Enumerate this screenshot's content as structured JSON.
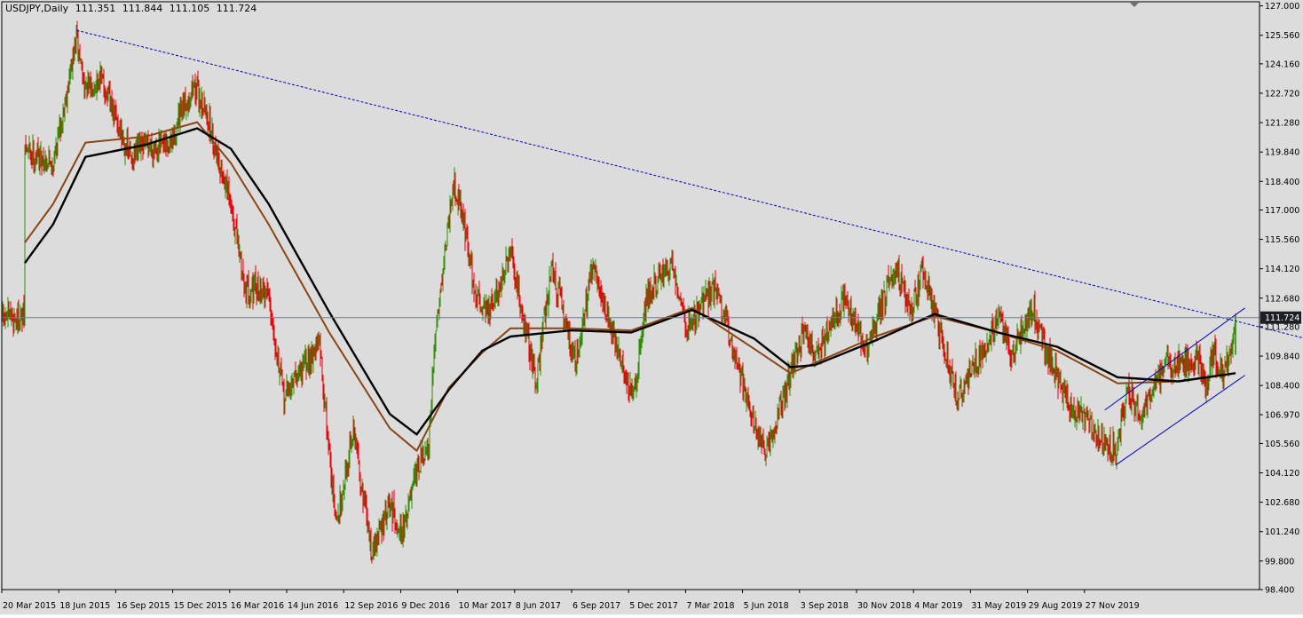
{
  "header": {
    "symbol": "USDJPY,Daily",
    "open": "111.351",
    "high": "111.844",
    "low": "111.105",
    "close": "111.724"
  },
  "colors": {
    "background": "#dcdcdc",
    "frame": "#000000",
    "bull_candle": "#2f8f00",
    "bear_candle": "#e8000b",
    "ma_fast": "#8b4513",
    "ma_slow": "#000000",
    "trendlines": "#0000cc",
    "price_line": "#6e7f8f",
    "current_price_bg": "#1c2026",
    "current_price_fg": "#ffffff"
  },
  "chart_data": {
    "type": "candlestick",
    "symbol": "USDJPY",
    "timeframe": "Daily",
    "current_price": 111.724,
    "y_range": [
      98.4,
      127.2
    ],
    "y_ticks": [
      "127.000",
      "125.560",
      "124.160",
      "122.720",
      "121.280",
      "119.840",
      "118.400",
      "117.000",
      "115.560",
      "114.120",
      "112.680",
      "111.280",
      "109.840",
      "108.400",
      "106.970",
      "105.560",
      "104.120",
      "102.680",
      "101.240",
      "99.800",
      "98.400"
    ],
    "x_ticks": [
      "20 Mar 2015",
      "18 Jun 2015",
      "16 Sep 2015",
      "15 Dec 2015",
      "16 Mar 2016",
      "14 Jun 2016",
      "12 Sep 2016",
      "9 Dec 2016",
      "10 Mar 2017",
      "8 Jun 2017",
      "6 Sep 2017",
      "5 Dec 2017",
      "7 Mar 2018",
      "5 Jun 2018",
      "3 Sep 2018",
      "30 Nov 2018",
      "4 Mar 2019",
      "31 May 2019",
      "29 Aug 2019",
      "27 Nov 2019"
    ],
    "price_path": [
      {
        "date": "2015-03-20",
        "close": 120.0
      },
      {
        "date": "2015-05-01",
        "close": 119.3
      },
      {
        "date": "2015-06-05",
        "close": 125.4
      },
      {
        "date": "2015-06-18",
        "close": 122.8
      },
      {
        "date": "2015-07-10",
        "close": 123.5
      },
      {
        "date": "2015-08-24",
        "close": 119.5
      },
      {
        "date": "2015-09-16",
        "close": 120.2
      },
      {
        "date": "2015-10-20",
        "close": 120.0
      },
      {
        "date": "2015-11-25",
        "close": 123.2
      },
      {
        "date": "2015-12-15",
        "close": 121.7
      },
      {
        "date": "2016-01-20",
        "close": 117.2
      },
      {
        "date": "2016-02-10",
        "close": 113.2
      },
      {
        "date": "2016-03-16",
        "close": 113.0
      },
      {
        "date": "2016-04-07",
        "close": 107.8
      },
      {
        "date": "2016-05-10",
        "close": 109.5
      },
      {
        "date": "2016-05-30",
        "close": 110.5
      },
      {
        "date": "2016-06-14",
        "close": 105.2
      },
      {
        "date": "2016-06-24",
        "close": 101.5
      },
      {
        "date": "2016-07-20",
        "close": 106.3
      },
      {
        "date": "2016-08-16",
        "close": 100.2
      },
      {
        "date": "2016-09-12",
        "close": 102.5
      },
      {
        "date": "2016-09-30",
        "close": 101.2
      },
      {
        "date": "2016-10-28",
        "close": 104.8
      },
      {
        "date": "2016-11-09",
        "close": 105.2
      },
      {
        "date": "2016-11-18",
        "close": 110.9
      },
      {
        "date": "2016-12-15",
        "close": 118.4
      },
      {
        "date": "2016-12-27",
        "close": 117.2
      },
      {
        "date": "2017-01-17",
        "close": 112.8
      },
      {
        "date": "2017-02-08",
        "close": 112.0
      },
      {
        "date": "2017-03-10",
        "close": 114.8
      },
      {
        "date": "2017-04-17",
        "close": 108.6
      },
      {
        "date": "2017-05-10",
        "close": 114.3
      },
      {
        "date": "2017-06-14",
        "close": 109.6
      },
      {
        "date": "2017-07-11",
        "close": 114.2
      },
      {
        "date": "2017-09-08",
        "close": 107.6
      },
      {
        "date": "2017-09-28",
        "close": 112.8
      },
      {
        "date": "2017-11-06",
        "close": 114.4
      },
      {
        "date": "2017-11-27",
        "close": 111.2
      },
      {
        "date": "2018-01-08",
        "close": 113.3
      },
      {
        "date": "2018-03-23",
        "close": 104.8
      },
      {
        "date": "2018-05-21",
        "close": 111.2
      },
      {
        "date": "2018-06-05",
        "close": 109.8
      },
      {
        "date": "2018-07-19",
        "close": 112.6
      },
      {
        "date": "2018-08-21",
        "close": 110.1
      },
      {
        "date": "2018-10-04",
        "close": 114.4
      },
      {
        "date": "2018-10-26",
        "close": 111.9
      },
      {
        "date": "2018-11-12",
        "close": 114.1
      },
      {
        "date": "2019-01-03",
        "close": 107.7
      },
      {
        "date": "2019-02-15",
        "close": 110.5
      },
      {
        "date": "2019-03-04",
        "close": 111.8
      },
      {
        "date": "2019-03-25",
        "close": 109.9
      },
      {
        "date": "2019-04-24",
        "close": 112.2
      },
      {
        "date": "2019-05-31",
        "close": 108.7
      },
      {
        "date": "2019-06-25",
        "close": 107.2
      },
      {
        "date": "2019-08-26",
        "close": 105.2
      },
      {
        "date": "2019-09-12",
        "close": 108.1
      },
      {
        "date": "2019-10-03",
        "close": 106.8
      },
      {
        "date": "2019-11-05",
        "close": 109.4
      },
      {
        "date": "2019-11-27",
        "close": 109.5
      },
      {
        "date": "2019-12-26",
        "close": 109.6
      },
      {
        "date": "2020-01-08",
        "close": 108.3
      },
      {
        "date": "2020-01-17",
        "close": 110.2
      },
      {
        "date": "2020-01-31",
        "close": 108.9
      },
      {
        "date": "2020-02-13",
        "close": 109.8
      },
      {
        "date": "2020-02-20",
        "close": 111.724
      }
    ],
    "moving_averages": [
      {
        "name": "MA brown",
        "color": "#8b4513",
        "points": [
          {
            "date": "2015-03-20",
            "close": 115.4
          },
          {
            "date": "2015-05-01",
            "close": 117.3
          },
          {
            "date": "2015-06-18",
            "close": 120.3
          },
          {
            "date": "2015-09-16",
            "close": 120.6
          },
          {
            "date": "2015-12-01",
            "close": 121.3
          },
          {
            "date": "2016-01-20",
            "close": 119.3
          },
          {
            "date": "2016-03-16",
            "close": 116.3
          },
          {
            "date": "2016-06-14",
            "close": 111.0
          },
          {
            "date": "2016-09-12",
            "close": 106.3
          },
          {
            "date": "2016-10-22",
            "close": 105.2
          },
          {
            "date": "2016-12-09",
            "close": 108.3
          },
          {
            "date": "2017-01-27",
            "close": 110.0
          },
          {
            "date": "2017-03-10",
            "close": 111.2
          },
          {
            "date": "2017-06-08",
            "close": 111.2
          },
          {
            "date": "2017-09-06",
            "close": 111.1
          },
          {
            "date": "2017-12-05",
            "close": 112.2
          },
          {
            "date": "2018-03-07",
            "close": 110.2
          },
          {
            "date": "2018-04-30",
            "close": 109.0
          },
          {
            "date": "2018-06-05",
            "close": 109.5
          },
          {
            "date": "2018-09-03",
            "close": 110.8
          },
          {
            "date": "2018-11-30",
            "close": 111.8
          },
          {
            "date": "2019-03-04",
            "close": 111.0
          },
          {
            "date": "2019-05-31",
            "close": 110.1
          },
          {
            "date": "2019-08-29",
            "close": 108.5
          },
          {
            "date": "2019-11-27",
            "close": 108.6
          },
          {
            "date": "2020-02-20",
            "close": 109.0
          }
        ]
      },
      {
        "name": "MA black",
        "color": "#000000",
        "points": [
          {
            "date": "2015-03-20",
            "close": 114.4
          },
          {
            "date": "2015-05-01",
            "close": 116.3
          },
          {
            "date": "2015-06-18",
            "close": 119.6
          },
          {
            "date": "2015-09-16",
            "close": 120.2
          },
          {
            "date": "2015-12-01",
            "close": 121.0
          },
          {
            "date": "2016-01-20",
            "close": 120.0
          },
          {
            "date": "2016-03-16",
            "close": 117.3
          },
          {
            "date": "2016-06-14",
            "close": 112.0
          },
          {
            "date": "2016-09-12",
            "close": 107.0
          },
          {
            "date": "2016-10-22",
            "close": 106.0
          },
          {
            "date": "2016-12-09",
            "close": 108.2
          },
          {
            "date": "2017-01-27",
            "close": 110.1
          },
          {
            "date": "2017-03-10",
            "close": 110.8
          },
          {
            "date": "2017-06-08",
            "close": 111.1
          },
          {
            "date": "2017-09-06",
            "close": 111.0
          },
          {
            "date": "2017-12-05",
            "close": 112.1
          },
          {
            "date": "2018-03-07",
            "close": 110.7
          },
          {
            "date": "2018-04-30",
            "close": 109.3
          },
          {
            "date": "2018-06-05",
            "close": 109.4
          },
          {
            "date": "2018-09-03",
            "close": 110.6
          },
          {
            "date": "2018-11-30",
            "close": 111.9
          },
          {
            "date": "2019-03-04",
            "close": 111.0
          },
          {
            "date": "2019-05-31",
            "close": 110.3
          },
          {
            "date": "2019-08-29",
            "close": 108.8
          },
          {
            "date": "2019-11-27",
            "close": 108.6
          },
          {
            "date": "2020-02-20",
            "close": 109.0
          }
        ]
      }
    ],
    "trendlines": [
      {
        "name": "descending resistance",
        "style": "dotted",
        "start": {
          "date": "2015-06-05",
          "price": 125.8
        },
        "end": {
          "date": "2020-06-15",
          "price": 110.6
        }
      },
      {
        "name": "channel upper",
        "style": "solid",
        "start": {
          "date": "2019-08-10",
          "price": 107.2
        },
        "end": {
          "date": "2020-03-05",
          "price": 112.2
        }
      },
      {
        "name": "channel lower",
        "style": "solid",
        "start": {
          "date": "2019-08-26",
          "price": 104.5
        },
        "end": {
          "date": "2020-03-05",
          "price": 108.9
        }
      }
    ],
    "grid": false
  }
}
